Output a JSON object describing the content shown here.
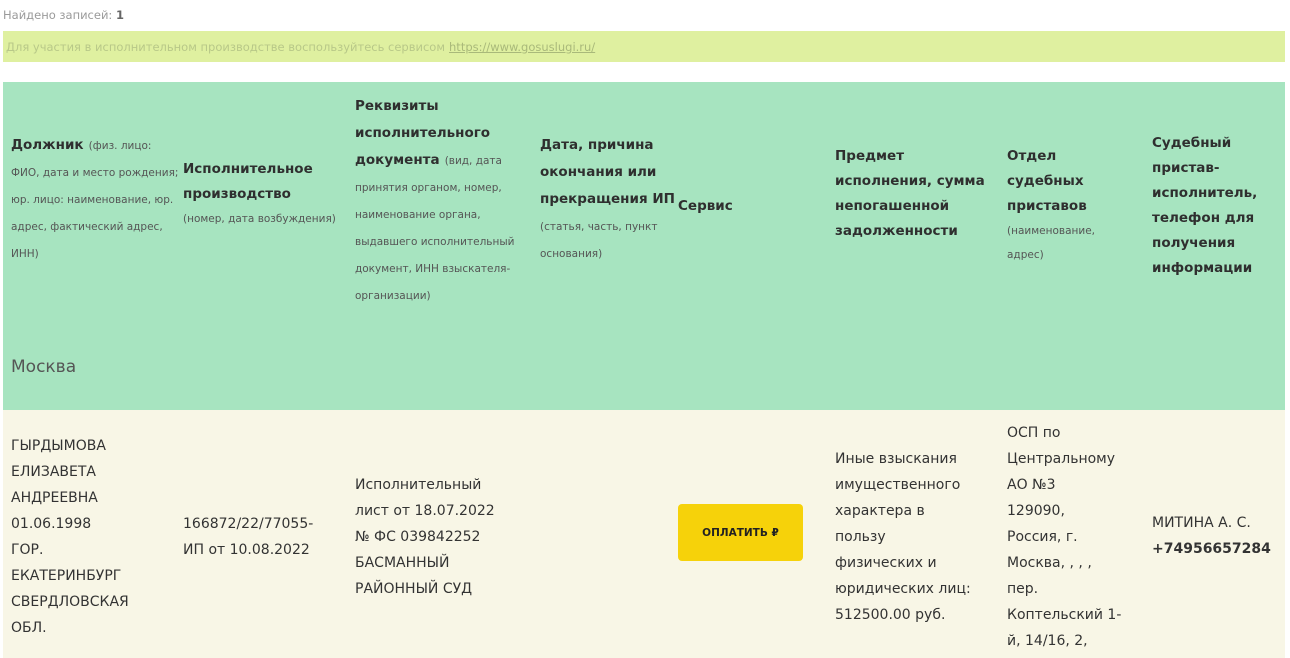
{
  "summary": {
    "found_label": "Найдено записей:",
    "found_count": "1"
  },
  "notice": {
    "text": "Для участия в исполнительном производстве воспользуйтесь сервисом",
    "link": "https://www.gosuslugi.ru/"
  },
  "headers": {
    "debtor_title": "Должник",
    "debtor_sub": "(физ. лицо: ФИО, дата и место рождения; юр. лицо: наименование, юр. адрес, фактический адрес, ИНН)",
    "proceeding_title": "Исполнительное производство",
    "proceeding_sub": "(номер, дата возбуждения)",
    "document_title": "Реквизиты исполнительного документа",
    "document_sub": "(вид, дата принятия органом, номер, наименование органа, выдавшего исполнительный документ, ИНН взыскателя-организации)",
    "end_title": "Дата, причина окончания или прекращения ИП",
    "end_sub": "(статья, часть, пункт основания)",
    "service_title": "Сервис",
    "subject_title": "Предмет исполнения, сумма непогашенной задолженности",
    "department_title": "Отдел судебных приставов",
    "department_sub": "(наименование, адрес)",
    "bailiff_title": "Судебный пристав-исполнитель, телефон для получения информации"
  },
  "region": "Москва",
  "record": {
    "debtor_lines": [
      "ГЫРДЫМОВА",
      "ЕЛИЗАВЕТА",
      "АНДРЕЕВНА",
      "01.06.1998",
      "ГОР.",
      "ЕКАТЕРИНБУРГ",
      "СВЕРДЛОВСКАЯ",
      "ОБЛ."
    ],
    "proceeding_lines": [
      "166872/22/77055-",
      "ИП от 10.08.2022"
    ],
    "document_lines": [
      "Исполнительный",
      "лист от 18.07.2022",
      "№ ФС 039842252",
      "БАСМАННЫЙ",
      "РАЙОННЫЙ СУД"
    ],
    "pay_button": "ОПЛАТИТЬ ₽",
    "subject_lines": [
      "Иные взыскания",
      "имущественного",
      "характера в",
      "пользу",
      "физических и",
      "юридических лиц:",
      "512500.00 руб."
    ],
    "department_lines": [
      "ОСП по",
      "Центральному",
      "АО №3",
      "129090,",
      "Россия, г.",
      "Москва, , , ,",
      "пер.",
      "Коптельский 1-",
      "й, 14/16, 2,"
    ],
    "bailiff_name": "МИТИНА А. С.",
    "bailiff_phone": "+74956657284"
  }
}
